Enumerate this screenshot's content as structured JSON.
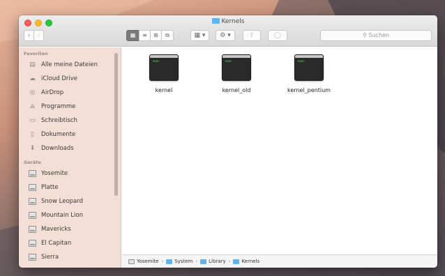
{
  "window": {
    "title": "Kernels",
    "search_placeholder": "Suchen"
  },
  "toolbar": {
    "back_glyph": "‹",
    "forward_glyph": "›",
    "view_icon": "▦",
    "view_list": "≡",
    "view_columns": "⊞",
    "view_coverflow": "⧉",
    "arrange_glyph": "▦ ▾",
    "action_glyph": "⚙ ▾",
    "share_glyph": "⇪",
    "tag_glyph": "◯"
  },
  "sidebar": {
    "favorites_header": "Favoriten",
    "favorites": [
      {
        "label": "Alle meine Dateien",
        "icon": "all-files-icon",
        "glyph": "▤"
      },
      {
        "label": "iCloud Drive",
        "icon": "cloud-icon",
        "glyph": "☁"
      },
      {
        "label": "AirDrop",
        "icon": "airdrop-icon",
        "glyph": "◎"
      },
      {
        "label": "Programme",
        "icon": "applications-icon",
        "glyph": "⟁"
      },
      {
        "label": "Schreibtisch",
        "icon": "desktop-icon",
        "glyph": "▭"
      },
      {
        "label": "Dokumente",
        "icon": "documents-icon",
        "glyph": "▯"
      },
      {
        "label": "Downloads",
        "icon": "downloads-icon",
        "glyph": "⬇"
      }
    ],
    "devices_header": "Geräte",
    "devices": [
      {
        "label": "Yosemite"
      },
      {
        "label": "Platte"
      },
      {
        "label": "Snow Leopard"
      },
      {
        "label": "Mountain Lion"
      },
      {
        "label": "Mavericks"
      },
      {
        "label": "El Capitan"
      },
      {
        "label": "Sierra"
      }
    ]
  },
  "files": [
    {
      "name": "kernel",
      "badge": "exec"
    },
    {
      "name": "kernel_old",
      "badge": "exec"
    },
    {
      "name": "kernel_pentium",
      "badge": "exec"
    }
  ],
  "pathbar": {
    "segments": [
      "Yosemite",
      "System",
      "Library",
      "Kernels"
    ],
    "separator": "›"
  }
}
